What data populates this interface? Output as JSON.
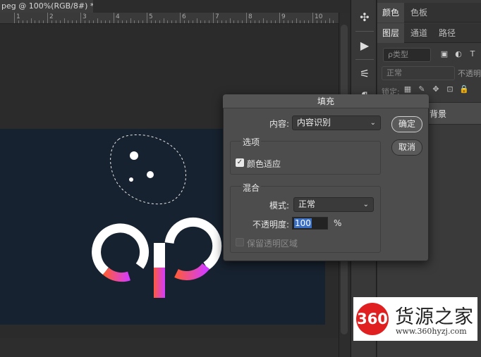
{
  "document": {
    "tab_title": "peg @ 100%(RGB/8#) *",
    "ruler_numbers": [
      "1",
      "2",
      "3",
      "4",
      "5",
      "6",
      "7",
      "8",
      "9",
      "10"
    ]
  },
  "tools": {
    "items": [
      {
        "name": "puzzle-icon",
        "glyph": "✣"
      },
      {
        "name": "play-icon",
        "glyph": "▶"
      },
      {
        "name": "brush-settings-icon",
        "glyph": "⚟"
      },
      {
        "name": "paragraph-icon",
        "glyph": "¶"
      }
    ]
  },
  "panel": {
    "top_tabs": [
      "颜色",
      "色板"
    ],
    "layer_tabs": [
      "图层",
      "通道",
      "路径"
    ],
    "filter_placeholder": "ρ类型",
    "blend_mode": "正常",
    "opacity_label": "不透明",
    "lock_label": "锁定:",
    "layer_name": "背景"
  },
  "dialog": {
    "title": "填充",
    "content_label": "内容:",
    "content_value": "内容识别",
    "ok_label": "确定",
    "cancel_label": "取消",
    "options_title": "选项",
    "color_adapt_label": "颜色适应",
    "color_adapt_checked": true,
    "blend_title": "混合",
    "mode_label": "模式:",
    "mode_value": "正常",
    "opacity_label": "不透明度:",
    "opacity_value": "100",
    "opacity_unit": "%",
    "preserve_label": "保留透明区域",
    "preserve_checked": false
  },
  "watermark": {
    "logo": "360",
    "name": "货源之家",
    "url": "www.360hyzj.com"
  },
  "colors": {
    "artboard": "#172230",
    "gradient_start": "#ff5a3c",
    "gradient_end": "#d23cff",
    "selection_blue": "#3a6fc4",
    "watermark_red": "#e02020"
  }
}
